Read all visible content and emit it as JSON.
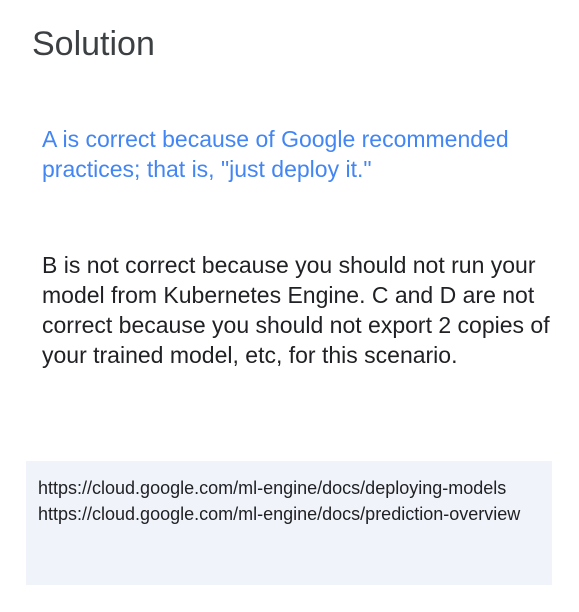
{
  "slide": {
    "title": "Solution",
    "correct_explanation": "A is correct because of Google recommended practices; that is, \"just deploy it.\"",
    "incorrect_explanation": "B is not correct because you should not run your model from Kubernetes Engine. C and D are not correct because you should not export 2 copies of your trained model, etc, for this scenario.",
    "references": [
      "https://cloud.google.com/ml-engine/docs/deploying-models",
      "https://cloud.google.com/ml-engine/docs/prediction-overview"
    ]
  },
  "colors": {
    "accent": "#4285f4",
    "text": "#202124",
    "reference_background": "#f1f3fa"
  }
}
